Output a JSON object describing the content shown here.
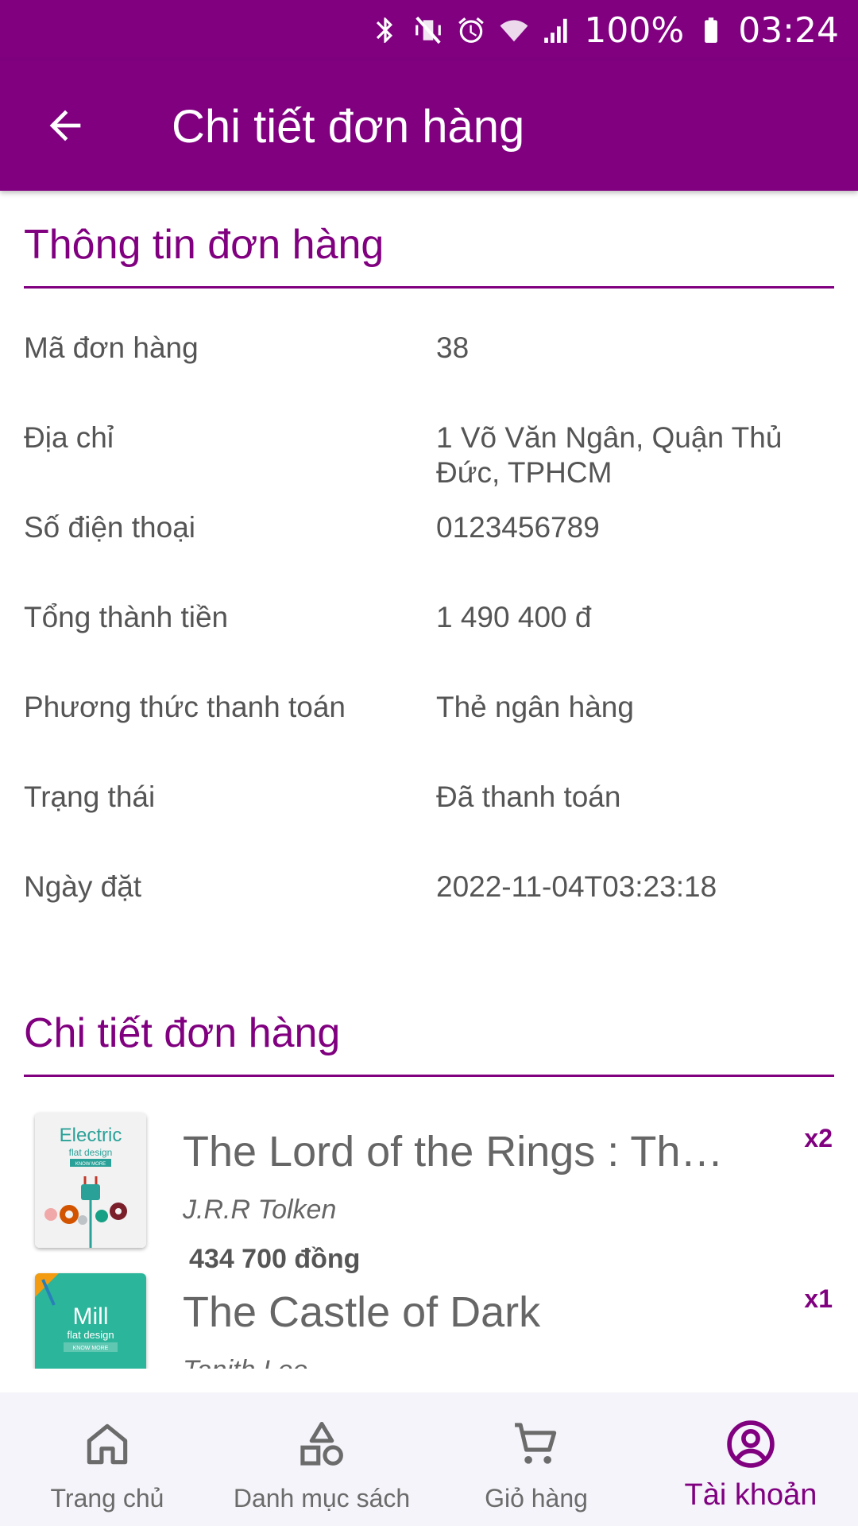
{
  "status_bar": {
    "icons": [
      "bluetooth-icon",
      "vibrate-mute-icon",
      "alarm-icon",
      "wifi-icon",
      "signal-icon",
      "battery-icon"
    ],
    "battery_text": "100%",
    "time": "03:24"
  },
  "app_bar": {
    "title": "Chi tiết đơn hàng",
    "back_icon": "arrow-left-icon"
  },
  "order_info": {
    "section_title": "Thông tin đơn hàng",
    "rows": [
      {
        "label": "Mã đơn hàng",
        "value": "38"
      },
      {
        "label": "Địa chỉ",
        "value": "1 Võ Văn Ngân, Quận Thủ Đức, TPHCM"
      },
      {
        "label": "Số điện thoại",
        "value": "0123456789"
      },
      {
        "label": "Tổng thành tiền",
        "value": "1 490 400 đ"
      },
      {
        "label": "Phương thức thanh toán",
        "value": "Thẻ ngân hàng"
      },
      {
        "label": "Trạng thái",
        "value": "Đã thanh toán"
      },
      {
        "label": "Ngày đặt",
        "value": "2022-11-04T03:23:18"
      }
    ]
  },
  "order_details": {
    "section_title": "Chi tiết đơn hàng",
    "items": [
      {
        "title": "The Lord of the Rings : The Return of the King",
        "author": "J.R.R Tolken",
        "price": "434 700 đồng",
        "quantity": "x2",
        "cover": {
          "title": "Electric",
          "subtitle": "flat design",
          "button": "KNOW MORE",
          "bg": "#f2f2f2",
          "accent": "#2aa198"
        }
      },
      {
        "title": "The Castle of Dark",
        "author": "Tanith Lee",
        "price": "",
        "quantity": "x1",
        "cover": {
          "title": "Mill",
          "subtitle": "flat design",
          "button": "KNOW MORE",
          "bg": "#2bb59a",
          "accent": "#ffffff"
        }
      }
    ]
  },
  "bottom_nav": {
    "items": [
      {
        "label": "Trang chủ",
        "icon": "home-icon",
        "active": false
      },
      {
        "label": "Danh mục sách",
        "icon": "shapes-icon",
        "active": false
      },
      {
        "label": "Giỏ hàng",
        "icon": "cart-icon",
        "active": false
      },
      {
        "label": "Tài khoản",
        "icon": "account-circle-icon",
        "active": true
      }
    ]
  },
  "colors": {
    "primary": "#800080",
    "text": "#555555",
    "nav_bg": "#f4f4fa"
  }
}
